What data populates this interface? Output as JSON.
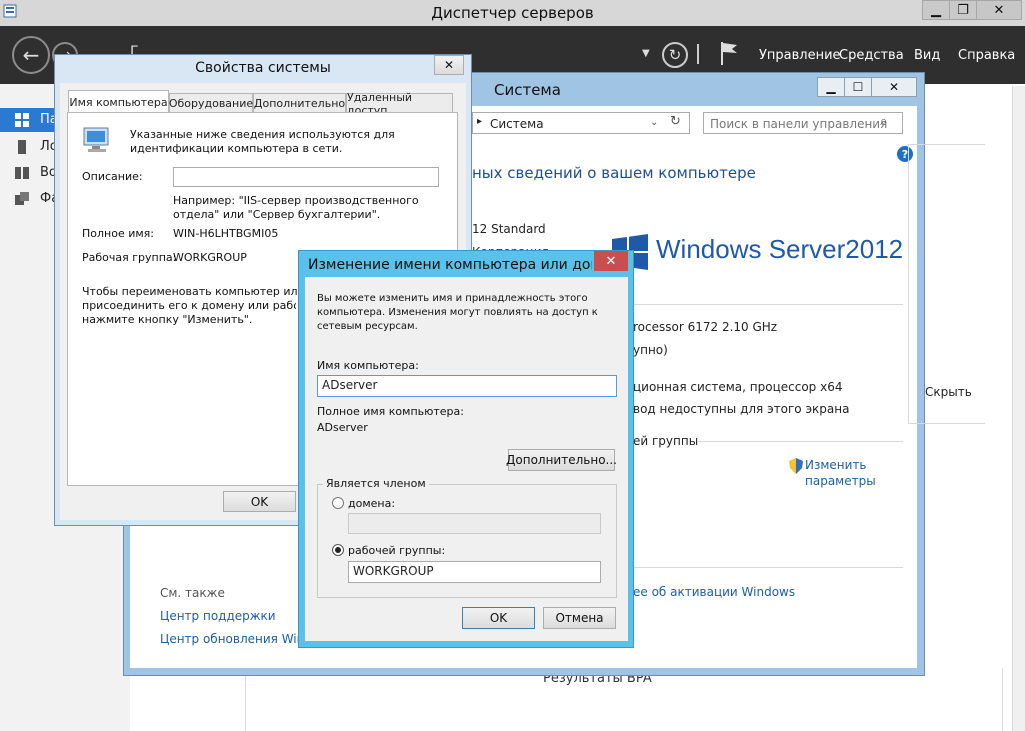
{
  "server_manager": {
    "title": "Диспетчер серверов",
    "menu": [
      "Управление",
      "Средства",
      "Вид",
      "Справка"
    ],
    "sidebar_items": [
      "Па",
      "Ло",
      "Во",
      "Фа"
    ],
    "sidebar_partial_text": "Г",
    "bpa_text": "Результаты BPA"
  },
  "system_window": {
    "title": "Система",
    "address": "Система",
    "search_placeholder": "Поиск в панели управления",
    "heading": "ных сведений о вашем компьютере",
    "edition": "12 Standard",
    "edition_line2": "Корпорация Майкрософт (Microsoft Corp.), 2012. Все права защищены.",
    "logo_text": "Windows Server",
    "logo_year": "2012",
    "processor": "rocessor 6172   2.10 GHz",
    "ram": "упно)",
    "system_type": "ционная система, процессор x64",
    "pen": "вод недоступны для этого экрана",
    "workgroup_section": "ей группы",
    "change_link_line1": "Изменить",
    "change_link_line2": "параметры",
    "hide": "Скрыть",
    "see_also": "См. также",
    "support_center": "Центр поддержки",
    "update_center": "Центр обновления Windo",
    "activation": "ее об активации Windows"
  },
  "props_dialog": {
    "title": "Свойства системы",
    "close": "✕",
    "tabs": [
      "Имя компьютера",
      "Оборудование",
      "Дополнительно",
      "Удаленный доступ"
    ],
    "intro": "Указанные ниже сведения используются для идентификации компьютера в сети.",
    "description_label": "Описание:",
    "description_value": "",
    "example": "Например: \"IIS-сервер производственного отдела\" или \"Сервер бухгалтерии\".",
    "fullname_label": "Полное имя:",
    "fullname_value": "WIN-H6LHTBGMI05",
    "workgroup_label": "Рабочая группа:",
    "workgroup_value": "WORKGROUP",
    "rename_hint_l1": "Чтобы переименовать компьютер или",
    "rename_hint_l2": "присоединить его к домену или рабочей гр",
    "rename_hint_l3": "нажмите кнопку \"Изменить\".",
    "ok": "OK"
  },
  "rename_dialog": {
    "title": "Изменение имени компьютера или дом…",
    "close": "✕",
    "intro": "Вы можете изменить имя и принадлежность этого компьютера. Изменения могут повлиять на доступ к сетевым ресурсам.",
    "computer_name_label": "Имя компьютера:",
    "computer_name_value": "ADserver",
    "full_name_label": "Полное имя компьютера:",
    "full_name_value": "ADserver",
    "more_button": "Дополнительно...",
    "member_of": "Является членом",
    "domain_label": "домена:",
    "domain_value": "",
    "workgroup_label": "рабочей группы:",
    "workgroup_value": "WORKGROUP",
    "ok": "OK",
    "cancel": "Отмена"
  },
  "colors": {
    "toolbar": "#2f2f2f",
    "rename_frame": "#5cc1e8",
    "link": "#1b5fa8",
    "close_red": "#c94f4f"
  }
}
